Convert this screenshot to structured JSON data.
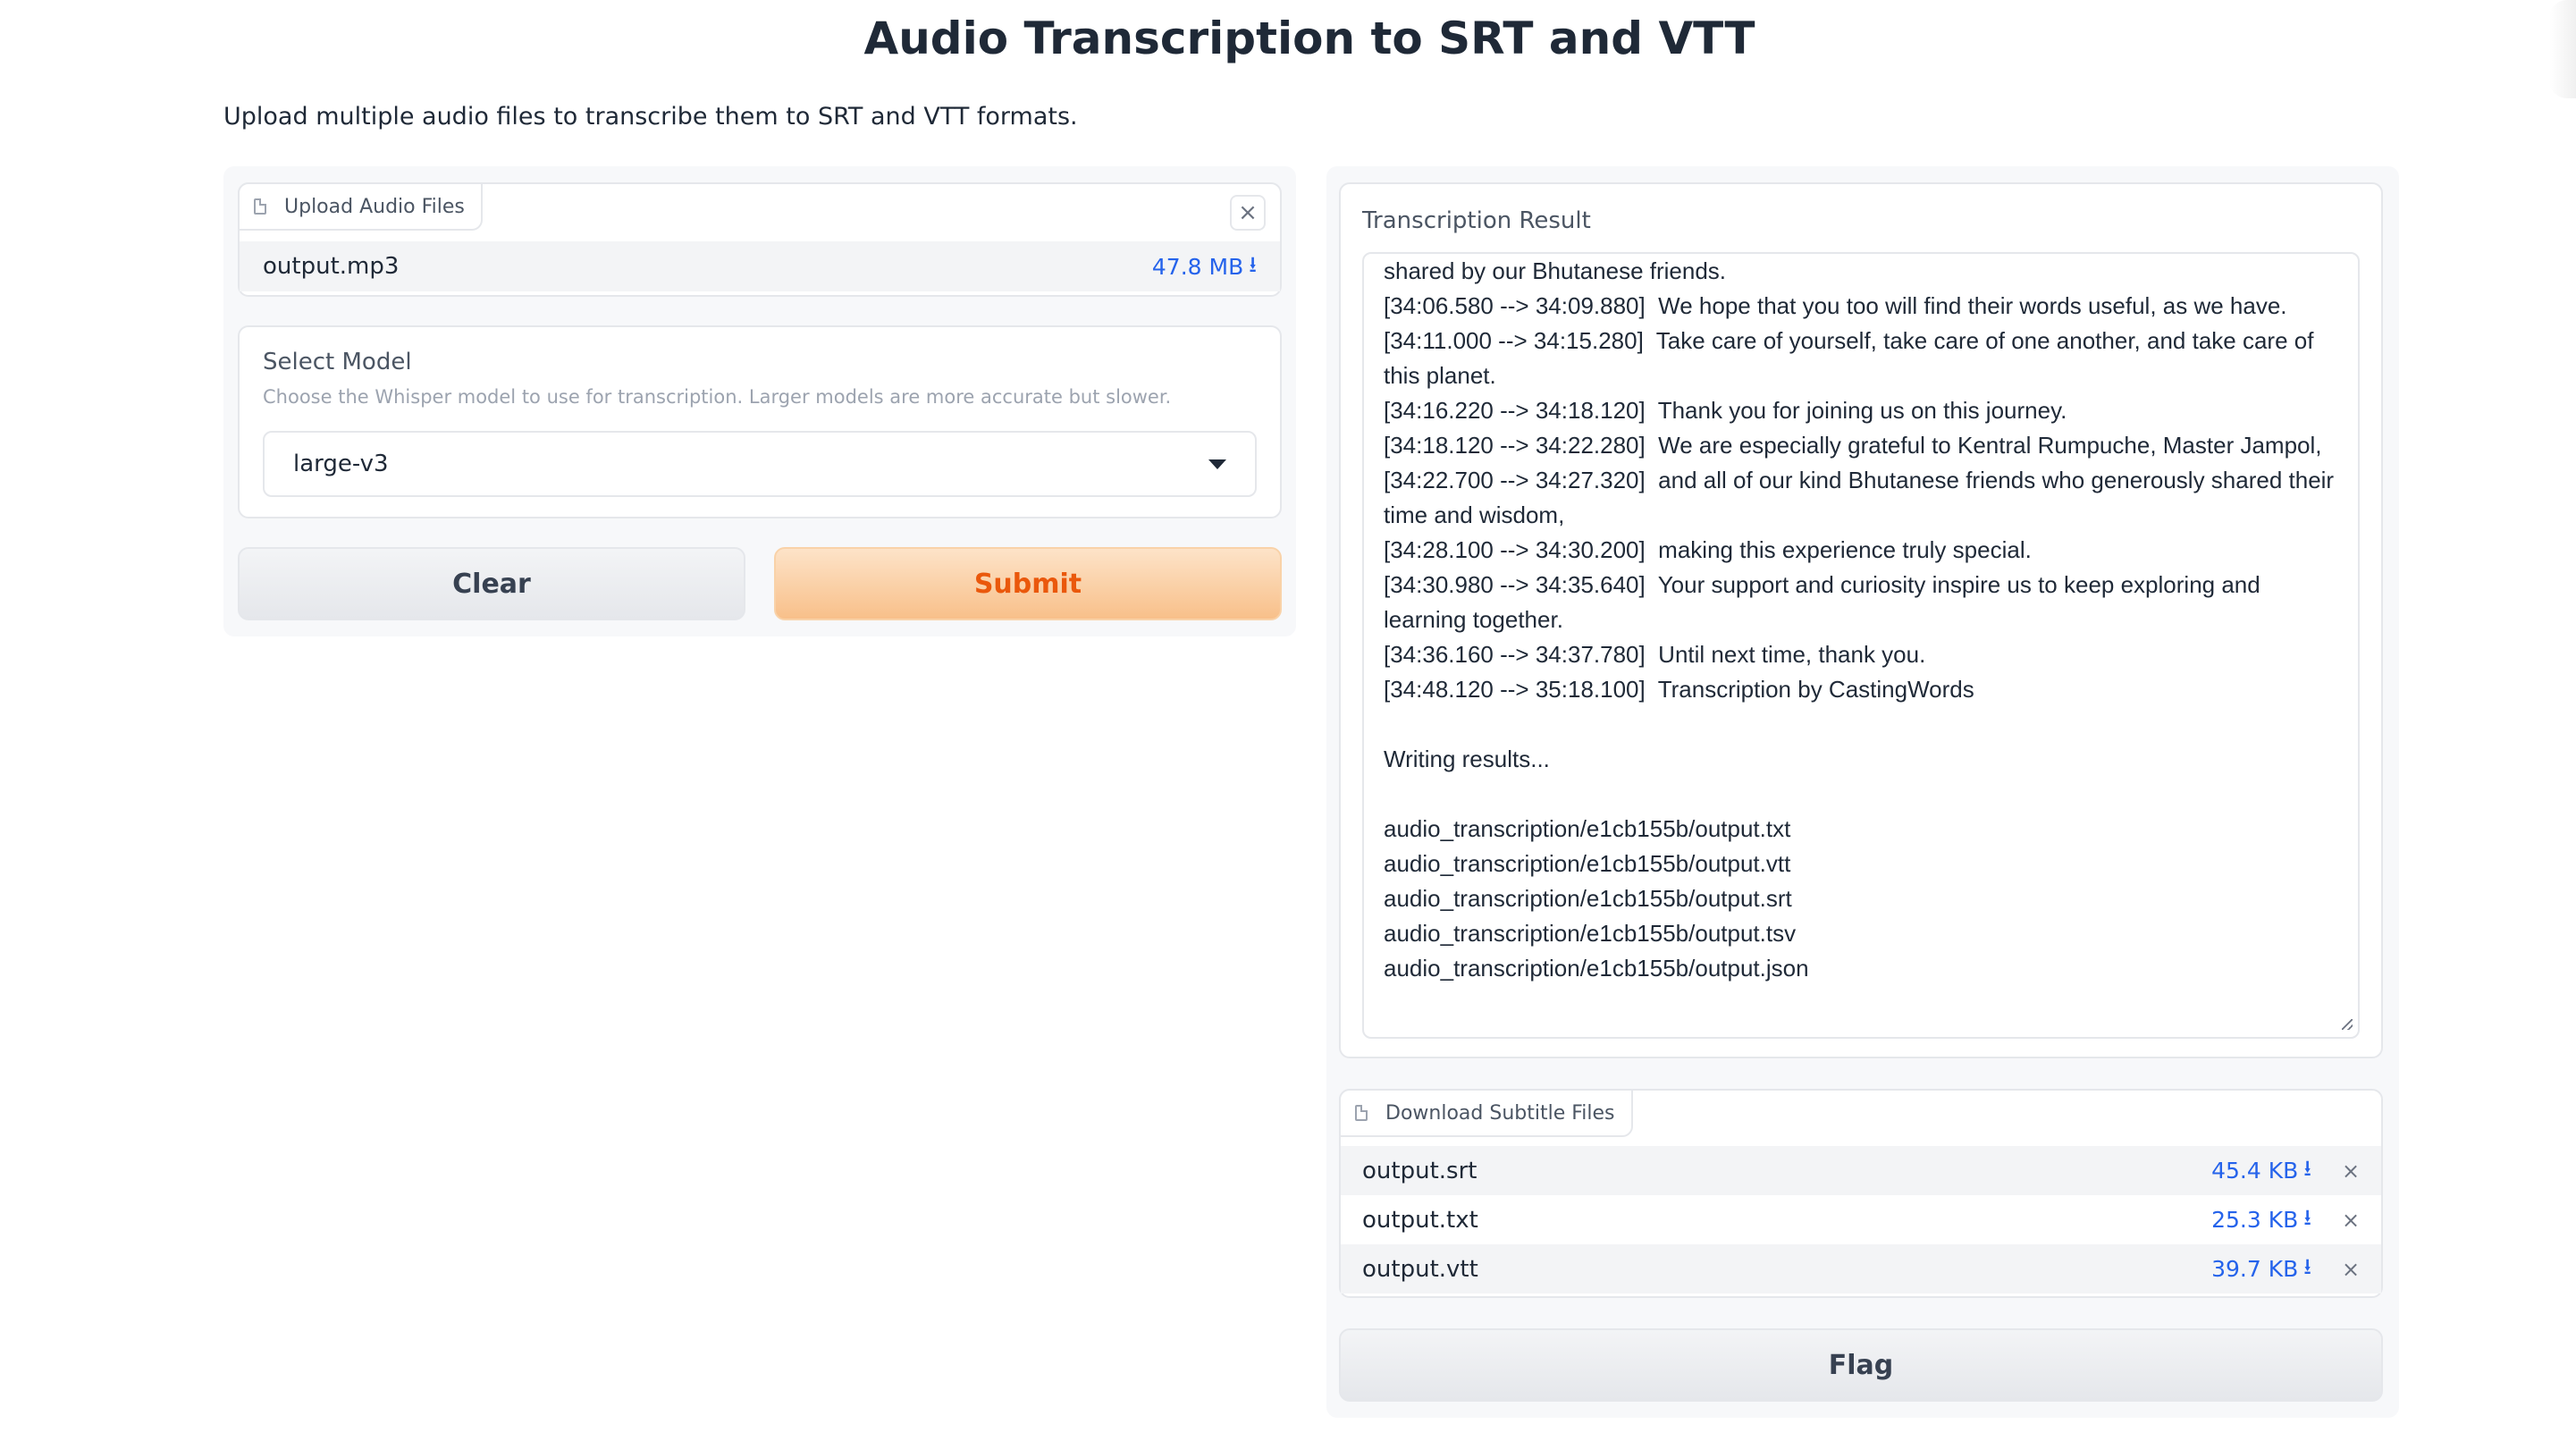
{
  "page": {
    "title": "Audio Transcription to SRT and VTT",
    "description": "Upload multiple audio files to transcribe them to SRT and VTT formats."
  },
  "upload": {
    "label": "Upload Audio Files",
    "icon": "file-icon",
    "clear_icon": "close-icon",
    "files": [
      {
        "name": "output.mp3",
        "size": "47.8 MB"
      }
    ]
  },
  "model": {
    "label": "Select Model",
    "info": "Choose the Whisper model to use for transcription. Larger models are more accurate but slower.",
    "selected": "large-v3"
  },
  "buttons": {
    "clear": "Clear",
    "submit": "Submit",
    "flag": "Flag"
  },
  "result": {
    "label": "Transcription Result",
    "text": "shared by our Bhutanese friends.\n[34:06.580 --> 34:09.880]  We hope that you too will find their words useful, as we have.\n[34:11.000 --> 34:15.280]  Take care of yourself, take care of one another, and take care of this planet.\n[34:16.220 --> 34:18.120]  Thank you for joining us on this journey.\n[34:18.120 --> 34:22.280]  We are especially grateful to Kentral Rumpuche, Master Jampol,\n[34:22.700 --> 34:27.320]  and all of our kind Bhutanese friends who generously shared their time and wisdom,\n[34:28.100 --> 34:30.200]  making this experience truly special.\n[34:30.980 --> 34:35.640]  Your support and curiosity inspire us to keep exploring and learning together.\n[34:36.160 --> 34:37.780]  Until next time, thank you.\n[34:48.120 --> 35:18.100]  Transcription by CastingWords\n\nWriting results...\n\naudio_transcription/e1cb155b/output.txt\naudio_transcription/e1cb155b/output.vtt\naudio_transcription/e1cb155b/output.srt\naudio_transcription/e1cb155b/output.tsv\naudio_transcription/e1cb155b/output.json"
  },
  "downloads": {
    "label": "Download Subtitle Files",
    "icon": "file-icon",
    "files": [
      {
        "name": "output.srt",
        "size": "45.4 KB"
      },
      {
        "name": "output.txt",
        "size": "25.3 KB"
      },
      {
        "name": "output.vtt",
        "size": "39.7 KB"
      }
    ]
  },
  "colors": {
    "accent": "#ea580c",
    "link": "#2563eb",
    "submit_bg": "#f8c08a"
  }
}
